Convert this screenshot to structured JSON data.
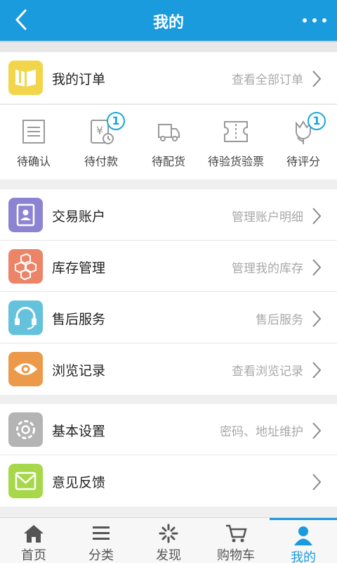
{
  "header": {
    "title": "我的",
    "back_icon": "back-chevron-icon",
    "more_icon": "more-dots-icon"
  },
  "orders": {
    "title": "我的订单",
    "link": "查看全部订单",
    "items": [
      {
        "label": "待确认",
        "icon": "list-icon",
        "badge": ""
      },
      {
        "label": "待付款",
        "icon": "payment-icon",
        "badge": "1"
      },
      {
        "label": "待配货",
        "icon": "truck-icon",
        "badge": ""
      },
      {
        "label": "待验货验票",
        "icon": "ticket-icon",
        "badge": ""
      },
      {
        "label": "待评分",
        "icon": "flower-icon",
        "badge": "1"
      }
    ]
  },
  "section2": [
    {
      "label": "交易账户",
      "sub": "管理账户明细",
      "color": "#8c83d2",
      "icon": "account-icon"
    },
    {
      "label": "库存管理",
      "sub": "管理我的库存",
      "color": "#ec8468",
      "icon": "boxes-icon"
    },
    {
      "label": "售后服务",
      "sub": "售后服务",
      "color": "#64c2dc",
      "icon": "headset-icon"
    },
    {
      "label": "浏览记录",
      "sub": "查看浏览记录",
      "color": "#ec9a4a",
      "icon": "eye-icon"
    }
  ],
  "section3": [
    {
      "label": "基本设置",
      "sub": "密码、地址维护",
      "color": "#b4b4b4",
      "icon": "gear-icon"
    },
    {
      "label": "意见反馈",
      "sub": "",
      "color": "#a6d84a",
      "icon": "message-icon"
    }
  ],
  "tabs": [
    {
      "label": "首页",
      "icon": "home-icon"
    },
    {
      "label": "分类",
      "icon": "menu-icon"
    },
    {
      "label": "发现",
      "icon": "discover-icon"
    },
    {
      "label": "购物车",
      "icon": "cart-icon"
    },
    {
      "label": "我的",
      "icon": "user-icon"
    }
  ],
  "colors": {
    "accent": "#1a9bdd",
    "orders_icon_bg": "#f2d54a",
    "badge": "#18a8d8"
  }
}
